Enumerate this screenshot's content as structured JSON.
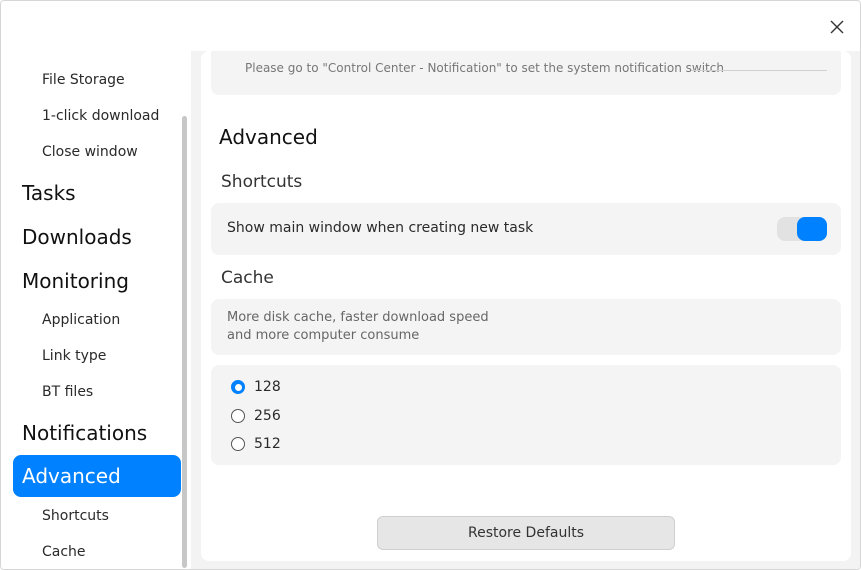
{
  "window": {
    "close_icon": "close-icon"
  },
  "sidebar": {
    "items": [
      {
        "label": "File Storage",
        "level": "sub"
      },
      {
        "label": "1-click download",
        "level": "sub"
      },
      {
        "label": "Close window",
        "level": "sub"
      },
      {
        "label": "Tasks",
        "level": "main"
      },
      {
        "label": "Downloads",
        "level": "main"
      },
      {
        "label": "Monitoring",
        "level": "main"
      },
      {
        "label": "Application",
        "level": "sub"
      },
      {
        "label": "Link type",
        "level": "sub"
      },
      {
        "label": "BT files",
        "level": "sub"
      },
      {
        "label": "Notifications",
        "level": "main"
      },
      {
        "label": "Advanced",
        "level": "main",
        "active": true
      },
      {
        "label": "Shortcuts",
        "level": "sub"
      },
      {
        "label": "Cache",
        "level": "sub"
      }
    ]
  },
  "notifications": {
    "notice": "Please go to \"Control Center - Notification\" to set the system notification switch"
  },
  "advanced": {
    "title": "Advanced",
    "shortcuts": {
      "title": "Shortcuts",
      "show_main_window_label": "Show main window when creating new task",
      "show_main_window_enabled": true
    },
    "cache": {
      "title": "Cache",
      "description_line1": "More disk cache, faster download speed",
      "description_line2": "and more computer consume",
      "options": [
        "128",
        "256",
        "512"
      ],
      "selected": "128"
    }
  },
  "footer": {
    "restore_label": "Restore Defaults"
  },
  "colors": {
    "accent": "#0081ff"
  }
}
